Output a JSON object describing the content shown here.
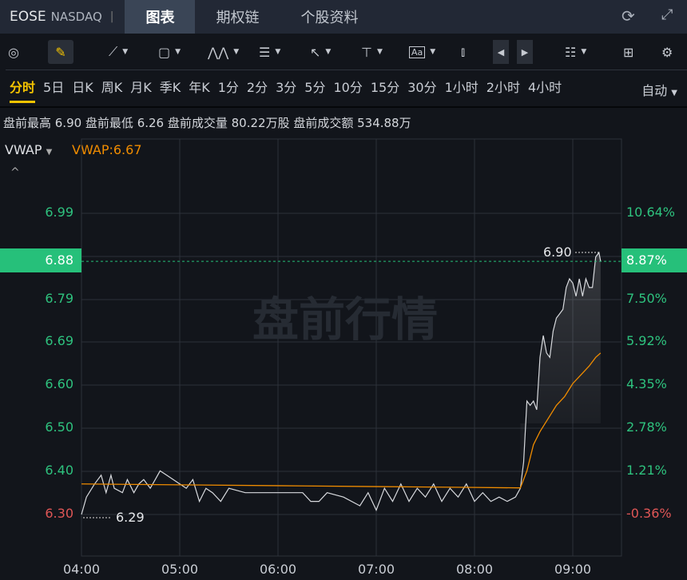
{
  "header": {
    "symbol": "EOSE",
    "exchange": "NASDAQ",
    "separator": "|",
    "tabs": [
      "图表",
      "期权链",
      "个股资料"
    ],
    "active_tab": "图表"
  },
  "toolbar": {
    "icons": [
      "gauge-icon",
      "pencil-icon",
      "line-icon",
      "rectangle-icon",
      "pattern-icon",
      "fibonacci-icon",
      "arrow-icon",
      "range-icon",
      "text-icon",
      "candle-icon",
      "prev-icon",
      "next-icon",
      "layout-list-icon",
      "grid-icon",
      "settings-icon"
    ]
  },
  "periods": [
    "分时",
    "5日",
    "日K",
    "周K",
    "月K",
    "季K",
    "年K",
    "1分",
    "2分",
    "3分",
    "5分",
    "10分",
    "15分",
    "30分",
    "1小时",
    "2小时",
    "4小时"
  ],
  "active_period": "分时",
  "auto_label": "自动",
  "stats": "盘前最高 6.90 盘前最低 6.26 盘前成交量 80.22万股 盘前成交额 534.88万",
  "indicator": {
    "name": "VWAP",
    "value_label": "VWAP:6.67"
  },
  "watermark": "盘前行情",
  "colors": {
    "up": "#2ec27e",
    "down": "#e05656",
    "vwap": "#f08c00",
    "active": "#f5c400"
  },
  "chart_data": {
    "type": "line",
    "yticks_left": [
      "6.99",
      "6.79",
      "6.69",
      "6.60",
      "6.50",
      "6.40",
      "6.30"
    ],
    "yticks_right": [
      "10.64%",
      "7.50%",
      "5.92%",
      "4.35%",
      "2.78%",
      "1.21%",
      "-0.36%"
    ],
    "current_price": "6.88",
    "current_pct": "8.87%",
    "xticks": [
      "04:00",
      "05:00",
      "06:00",
      "07:00",
      "08:00",
      "09:00"
    ],
    "ylim": [
      6.3,
      6.99
    ],
    "high_label": "6.90",
    "low_label": "6.29",
    "price": [
      [
        0,
        6.3
      ],
      [
        3,
        6.34
      ],
      [
        8,
        6.37
      ],
      [
        12,
        6.39
      ],
      [
        15,
        6.35
      ],
      [
        18,
        6.39
      ],
      [
        20,
        6.36
      ],
      [
        25,
        6.35
      ],
      [
        28,
        6.38
      ],
      [
        32,
        6.35
      ],
      [
        35,
        6.37
      ],
      [
        38,
        6.38
      ],
      [
        42,
        6.36
      ],
      [
        45,
        6.38
      ],
      [
        48,
        6.4
      ],
      [
        52,
        6.39
      ],
      [
        56,
        6.38
      ],
      [
        60,
        6.37
      ],
      [
        64,
        6.36
      ],
      [
        68,
        6.38
      ],
      [
        72,
        6.33
      ],
      [
        76,
        6.36
      ],
      [
        80,
        6.35
      ],
      [
        85,
        6.33
      ],
      [
        90,
        6.36
      ],
      [
        100,
        6.35
      ],
      [
        115,
        6.35
      ],
      [
        125,
        6.35
      ],
      [
        135,
        6.35
      ],
      [
        140,
        6.33
      ],
      [
        145,
        6.33
      ],
      [
        150,
        6.35
      ],
      [
        160,
        6.34
      ],
      [
        170,
        6.32
      ],
      [
        175,
        6.35
      ],
      [
        180,
        6.31
      ],
      [
        185,
        6.36
      ],
      [
        190,
        6.33
      ],
      [
        195,
        6.37
      ],
      [
        200,
        6.33
      ],
      [
        205,
        6.36
      ],
      [
        210,
        6.34
      ],
      [
        215,
        6.37
      ],
      [
        220,
        6.33
      ],
      [
        225,
        6.36
      ],
      [
        230,
        6.34
      ],
      [
        235,
        6.37
      ],
      [
        240,
        6.33
      ],
      [
        245,
        6.35
      ],
      [
        250,
        6.33
      ],
      [
        255,
        6.34
      ],
      [
        260,
        6.33
      ],
      [
        265,
        6.34
      ],
      [
        268,
        6.36
      ],
      [
        270,
        6.42
      ],
      [
        272,
        6.56
      ],
      [
        274,
        6.55
      ],
      [
        276,
        6.56
      ],
      [
        278,
        6.54
      ],
      [
        280,
        6.66
      ],
      [
        282,
        6.71
      ],
      [
        284,
        6.67
      ],
      [
        286,
        6.66
      ],
      [
        288,
        6.72
      ],
      [
        290,
        6.75
      ],
      [
        292,
        6.76
      ],
      [
        294,
        6.77
      ],
      [
        296,
        6.82
      ],
      [
        298,
        6.84
      ],
      [
        300,
        6.83
      ],
      [
        302,
        6.8
      ],
      [
        304,
        6.84
      ],
      [
        306,
        6.8
      ],
      [
        308,
        6.84
      ],
      [
        310,
        6.82
      ],
      [
        312,
        6.82
      ],
      [
        314,
        6.89
      ],
      [
        316,
        6.9
      ],
      [
        317,
        6.88
      ]
    ],
    "vwap": [
      [
        0,
        6.37
      ],
      [
        60,
        6.368
      ],
      [
        120,
        6.366
      ],
      [
        180,
        6.364
      ],
      [
        240,
        6.362
      ],
      [
        268,
        6.361
      ],
      [
        272,
        6.4
      ],
      [
        276,
        6.46
      ],
      [
        280,
        6.49
      ],
      [
        285,
        6.52
      ],
      [
        290,
        6.55
      ],
      [
        295,
        6.57
      ],
      [
        300,
        6.6
      ],
      [
        305,
        6.62
      ],
      [
        310,
        6.64
      ],
      [
        314,
        6.66
      ],
      [
        317,
        6.67
      ]
    ]
  }
}
